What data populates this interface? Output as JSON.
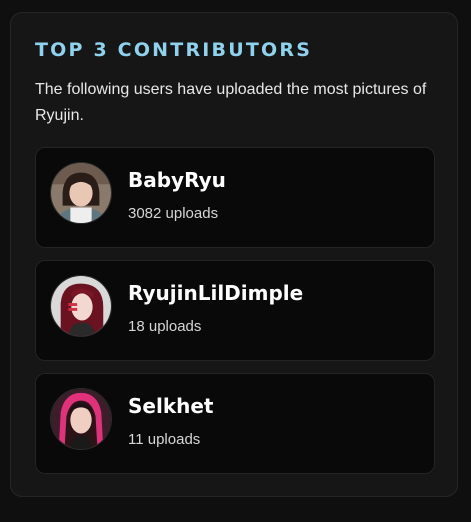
{
  "panel": {
    "title": "TOP 3 CONTRIBUTORS",
    "description": "The following users have uploaded the most pictures of Ryujin."
  },
  "contributors": [
    {
      "username": "BabyRyu",
      "uploads": "3082 uploads",
      "avatar_icon": "user-avatar-photo"
    },
    {
      "username": "RyujinLilDimple",
      "uploads": "18 uploads",
      "avatar_icon": "user-avatar-photo"
    },
    {
      "username": "Selkhet",
      "uploads": "11 uploads",
      "avatar_icon": "user-avatar-photo"
    }
  ],
  "colors": {
    "accent_title": "#8fd2ee",
    "panel_bg": "#161616",
    "card_bg": "#090909",
    "text_primary": "#ffffff",
    "text_secondary": "#d6d6d6"
  }
}
